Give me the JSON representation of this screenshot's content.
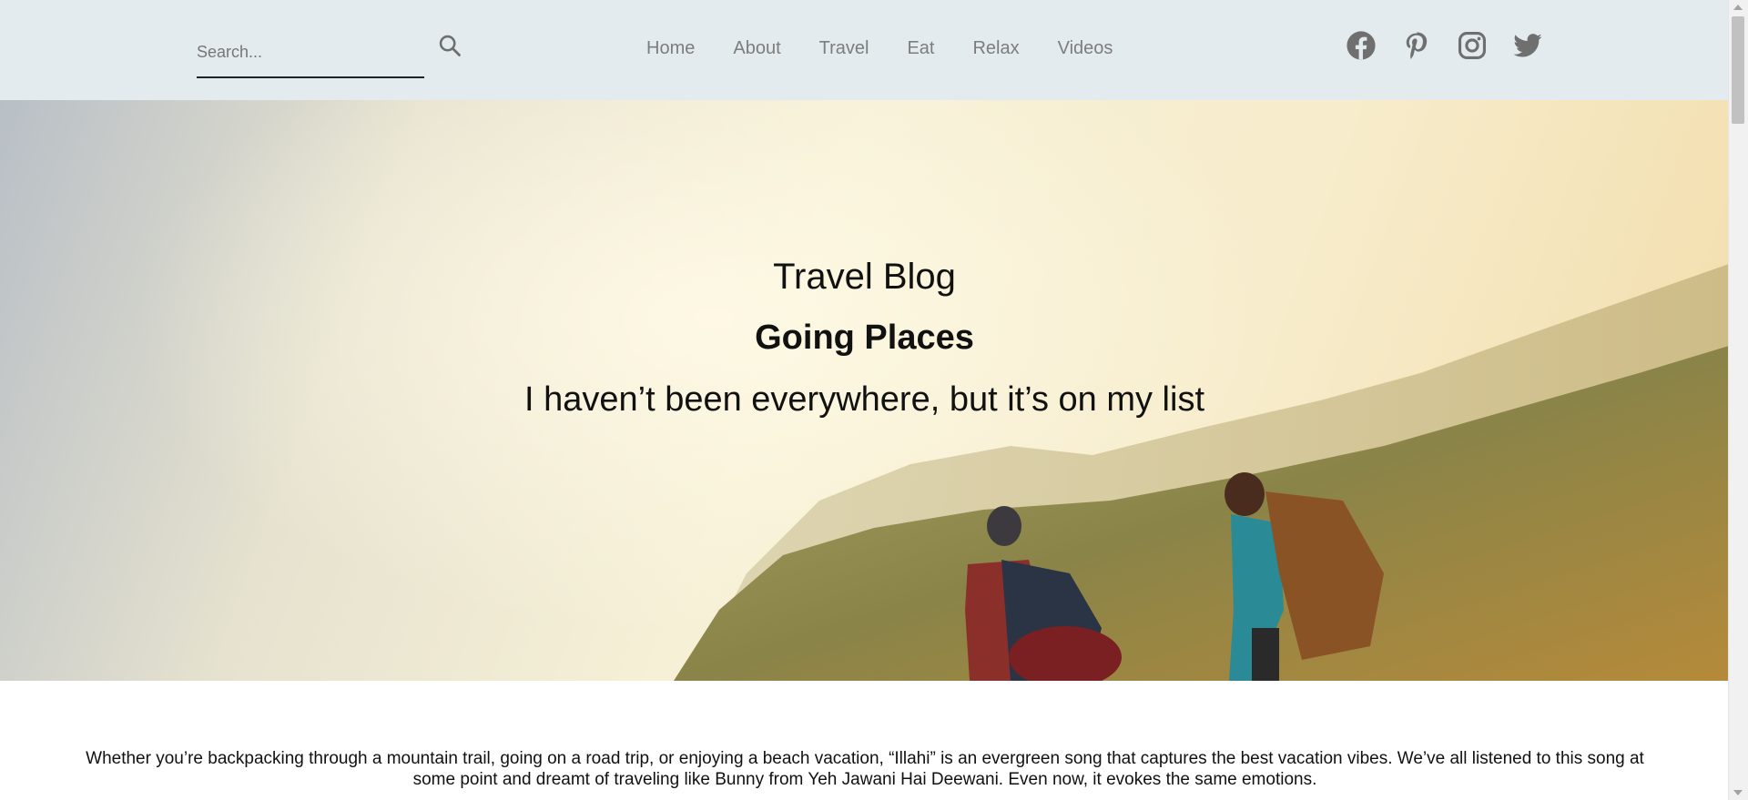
{
  "search": {
    "placeholder": "Search..."
  },
  "nav": {
    "items": [
      "Home",
      "About",
      "Travel",
      "Eat",
      "Relax",
      "Videos"
    ]
  },
  "socials": [
    "facebook-icon",
    "pinterest-icon",
    "instagram-icon",
    "twitter-icon"
  ],
  "hero": {
    "title": "Travel Blog",
    "subtitle": "Going Places",
    "tagline": "I haven’t been everywhere, but it’s on my list"
  },
  "intro": {
    "text": "Whether you’re backpacking through a mountain trail, going on a road trip, or enjoying a beach vacation, “Illahi” is an evergreen song that captures the best vacation vibes. We’ve all listened to this song at some point and dreamt of traveling like Bunny from Yeh Jawani Hai Deewani. Even now, it evokes the same emotions."
  },
  "colors": {
    "header_bg": "#e3ebee",
    "nav_text": "#7d7d7d",
    "icon": "#6f6f6f"
  }
}
